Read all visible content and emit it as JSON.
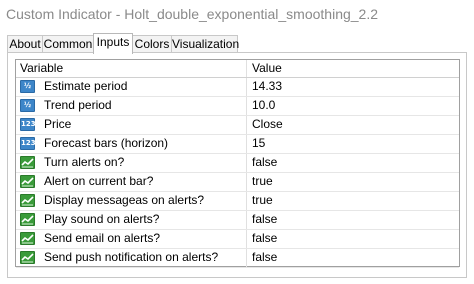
{
  "window": {
    "title": "Custom Indicator - Holt_double_exponential_smoothing_2.2"
  },
  "tabs": [
    {
      "label": "About",
      "active": false
    },
    {
      "label": "Common",
      "active": false
    },
    {
      "label": "Inputs",
      "active": true
    },
    {
      "label": "Colors",
      "active": false
    },
    {
      "label": "Visualization",
      "active": false
    }
  ],
  "table": {
    "headers": {
      "variable": "Variable",
      "value": "Value"
    },
    "rows": [
      {
        "variable": "Estimate period",
        "value": "14.33",
        "icon": "fraction-icon"
      },
      {
        "variable": "Trend period",
        "value": "10.0",
        "icon": "fraction-icon"
      },
      {
        "variable": "Price",
        "value": "Close",
        "icon": "integer-icon"
      },
      {
        "variable": "Forecast bars (horizon)",
        "value": "15",
        "icon": "integer-icon"
      },
      {
        "variable": "Turn alerts on?",
        "value": "false",
        "icon": "boolean-icon"
      },
      {
        "variable": "Alert on current bar?",
        "value": "true",
        "icon": "boolean-icon"
      },
      {
        "variable": "Display messageas on alerts?",
        "value": "true",
        "icon": "boolean-icon"
      },
      {
        "variable": "Play sound on alerts?",
        "value": "false",
        "icon": "boolean-icon"
      },
      {
        "variable": "Send email on alerts?",
        "value": "false",
        "icon": "boolean-icon"
      },
      {
        "variable": "Send push notification on alerts?",
        "value": "false",
        "icon": "boolean-icon"
      }
    ]
  },
  "icon_glyphs": {
    "fraction": "½",
    "integer": "123"
  },
  "colors": {
    "bool_icon": "#3a9b3a",
    "number_icon": "#3d86c9",
    "title_text": "#8a8a8a"
  }
}
